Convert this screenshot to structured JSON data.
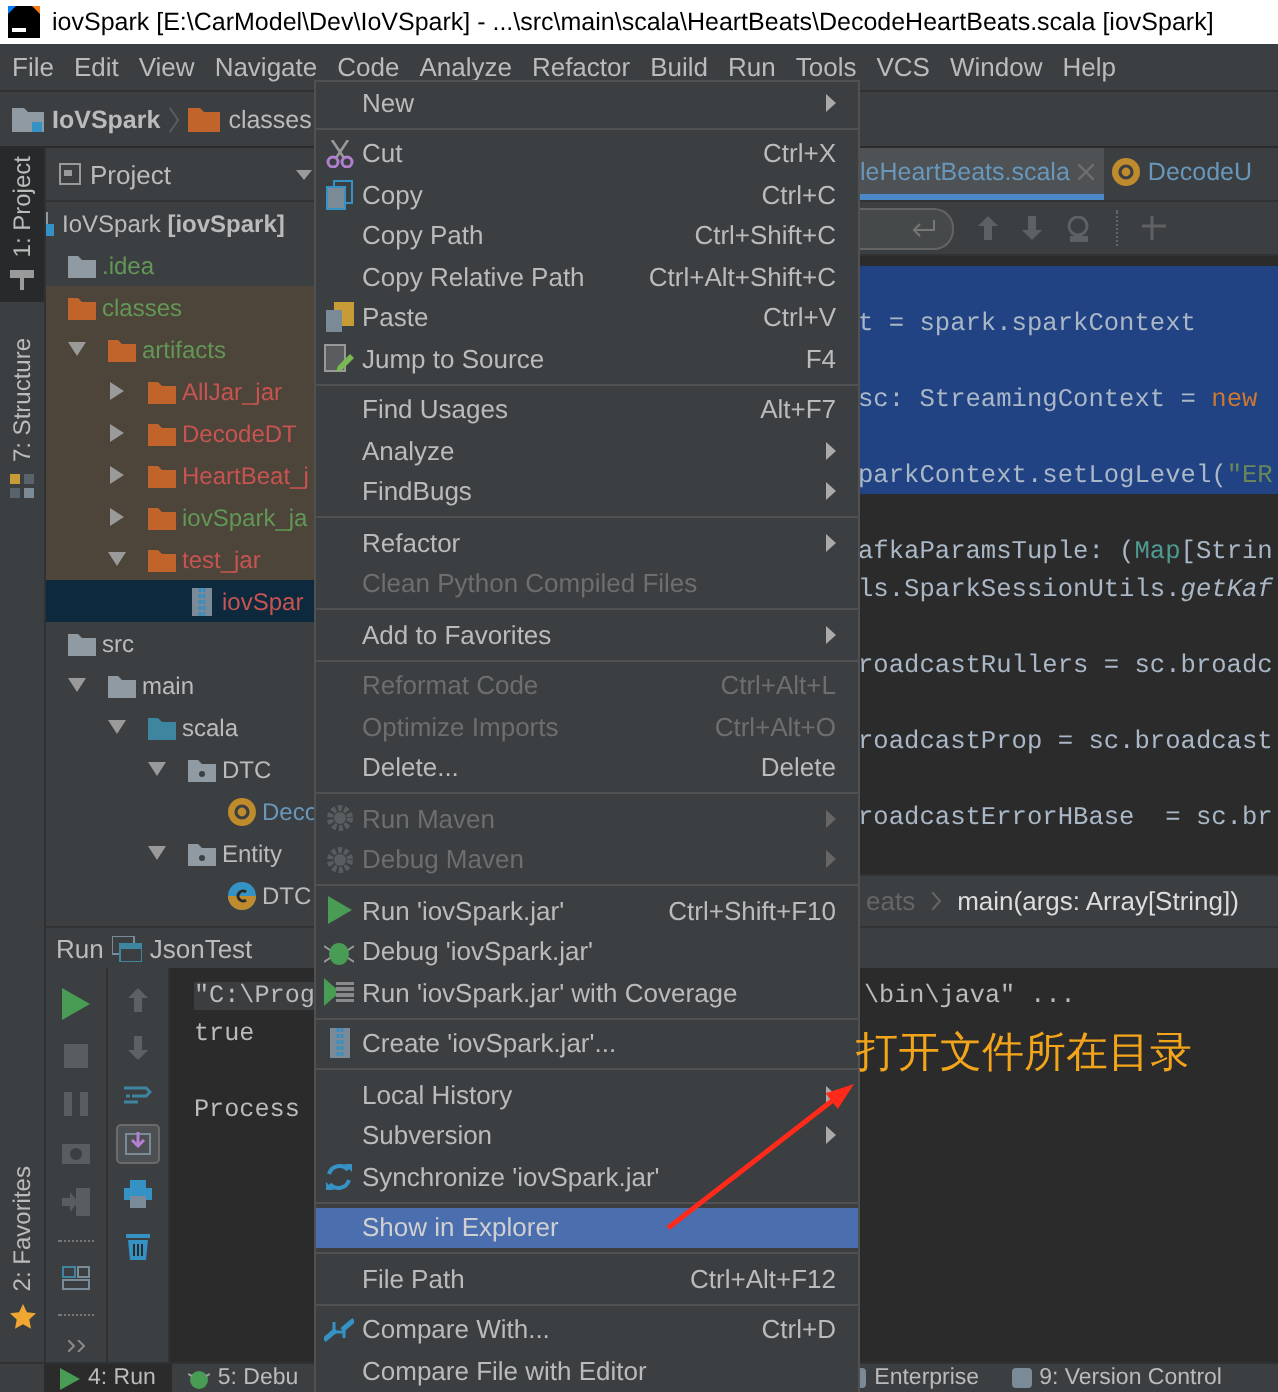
{
  "window": {
    "title": "iovSpark [E:\\CarModel\\Dev\\IoVSpark] - ...\\src\\main\\scala\\HeartBeats\\DecodeHeartBeats.scala [iovSpark]"
  },
  "menu_bar": [
    "File",
    "Edit",
    "View",
    "Navigate",
    "Code",
    "Analyze",
    "Refactor",
    "Build",
    "Run",
    "Tools",
    "VCS",
    "Window",
    "Help"
  ],
  "nav_bar": [
    {
      "label": "IoVSpark",
      "kind": "project"
    },
    {
      "label": "classes",
      "kind": "excluded-folder"
    }
  ],
  "tool_stripe": {
    "top": [
      {
        "label": "1: Project",
        "selected": true
      },
      {
        "label": "7: Structure",
        "selected": false
      }
    ],
    "bottom": [
      {
        "label": "2: Favorites",
        "selected": false
      }
    ]
  },
  "project_panel": {
    "title": "Project",
    "tree": [
      {
        "label": "IoVSpark **[iovSpark]**",
        "kind": "module",
        "color": "#bbbbbb",
        "selected": false,
        "excluded": false,
        "children": [
          {
            "label": ".idea",
            "kind": "folder",
            "color": "#629755",
            "selected": false,
            "excluded": false
          },
          {
            "label": "classes",
            "kind": "excluded-folder",
            "color": "#629755",
            "selected": false,
            "excluded": true,
            "children": [
              {
                "label": "artifacts",
                "kind": "excluded-folder",
                "color": "#629755",
                "selected": false,
                "excluded": true,
                "expanded": true,
                "children": [
                  {
                    "label": "AllJar_jar",
                    "kind": "excluded-folder",
                    "color": "#c75450",
                    "selected": false,
                    "excluded": true,
                    "expanded": false
                  },
                  {
                    "label": "DecodeDT",
                    "kind": "excluded-folder",
                    "color": "#c75450",
                    "selected": false,
                    "excluded": true,
                    "expanded": false
                  },
                  {
                    "label": "HeartBeat_j",
                    "kind": "excluded-folder",
                    "color": "#c75450",
                    "selected": false,
                    "excluded": true,
                    "expanded": false
                  },
                  {
                    "label": "iovSpark_ja",
                    "kind": "excluded-folder",
                    "color": "#629755",
                    "selected": false,
                    "excluded": true,
                    "expanded": false
                  },
                  {
                    "label": "test_jar",
                    "kind": "excluded-folder",
                    "color": "#c75450",
                    "selected": false,
                    "excluded": true,
                    "expanded": true,
                    "children": [
                      {
                        "label": "iovSpar",
                        "kind": "jar",
                        "color": "#c75450",
                        "selected": true,
                        "excluded": true
                      }
                    ]
                  }
                ]
              }
            ]
          },
          {
            "label": "src",
            "kind": "folder",
            "color": "#bbbbbb",
            "selected": false,
            "excluded": false,
            "children": [
              {
                "label": "main",
                "kind": "folder",
                "color": "#bbbbbb",
                "selected": false,
                "excluded": false,
                "expanded": true,
                "children": [
                  {
                    "label": "scala",
                    "kind": "source-folder",
                    "color": "#bbbbbb",
                    "selected": false,
                    "excluded": false,
                    "expanded": true,
                    "children": [
                      {
                        "label": "DTC",
                        "kind": "package",
                        "color": "#bbbbbb",
                        "selected": false,
                        "excluded": false,
                        "expanded": true,
                        "children": [
                          {
                            "label": "Deco",
                            "kind": "object",
                            "color": "#6897bb",
                            "selected": false,
                            "excluded": false
                          }
                        ]
                      },
                      {
                        "label": "Entity",
                        "kind": "package",
                        "color": "#bbbbbb",
                        "selected": false,
                        "excluded": false,
                        "expanded": true,
                        "children": [
                          {
                            "label": "DTC",
                            "kind": "class",
                            "color": "#bbbbbb",
                            "selected": false,
                            "excluded": false
                          }
                        ]
                      }
                    ]
                  }
                ]
              }
            ]
          }
        ]
      }
    ]
  },
  "editor": {
    "tabs": [
      {
        "label": "leHeartBeats.scala",
        "selected": true
      },
      {
        "label": "DecodeU",
        "selected": false
      }
    ],
    "lines": [
      {
        "kind": "blank",
        "selected": true
      },
      {
        "kind": "code",
        "selected": true,
        "segments": [
          {
            "kind": "plain",
            "text": "t = spark.sparkContext"
          }
        ]
      },
      {
        "kind": "blank",
        "selected": true
      },
      {
        "kind": "code",
        "selected": true,
        "segments": [
          {
            "kind": "plain",
            "text": "sc: StreamingContext = "
          },
          {
            "kind": "keyword",
            "text": "new"
          }
        ]
      },
      {
        "kind": "blank",
        "selected": true
      },
      {
        "kind": "code",
        "selected": true,
        "segments": [
          {
            "kind": "plain",
            "text": "parkContext.setLogLevel("
          },
          {
            "kind": "string",
            "text": "\"ER"
          }
        ]
      },
      {
        "kind": "blank",
        "selected": false
      },
      {
        "kind": "code",
        "selected": false,
        "segments": [
          {
            "kind": "plain",
            "text": "afkaParamsTuple: ("
          },
          {
            "kind": "type",
            "text": "Map"
          },
          {
            "kind": "plain",
            "text": "[Strin"
          }
        ]
      },
      {
        "kind": "code",
        "selected": false,
        "segments": [
          {
            "kind": "plain",
            "text": "ls.SparkSessionUtils."
          },
          {
            "kind": "italic",
            "text": "getKaf"
          }
        ]
      },
      {
        "kind": "blank",
        "selected": false
      },
      {
        "kind": "code",
        "selected": false,
        "segments": [
          {
            "kind": "plain",
            "text": "roadcastRullers = sc.broadc"
          }
        ]
      },
      {
        "kind": "blank",
        "selected": false
      },
      {
        "kind": "code",
        "selected": false,
        "segments": [
          {
            "kind": "plain",
            "text": "roadcastProp = sc.broadcast"
          }
        ]
      },
      {
        "kind": "blank",
        "selected": false
      },
      {
        "kind": "code",
        "selected": false,
        "segments": [
          {
            "kind": "plain",
            "text": "roadcastErrorHBase  = sc.br"
          }
        ]
      }
    ],
    "breadcrumb": [
      "eats",
      "main(args: Array[String])"
    ]
  },
  "run_panel": {
    "title": "Run",
    "config": "JsonTest",
    "console": [
      {
        "kind": "text",
        "left": "\"C:\\Prog",
        "right": "\\bin\\java\" ...",
        "highlighted": true
      },
      {
        "kind": "text",
        "left": "true",
        "highlighted": false
      },
      {
        "kind": "blank"
      },
      {
        "kind": "text",
        "left": "Process",
        "highlighted": false
      }
    ]
  },
  "context_menu": {
    "groups": [
      {
        "items": [
          {
            "label": "New",
            "submenu": true,
            "disabled": false,
            "selected": false
          }
        ]
      },
      {
        "items": [
          {
            "label": "Cut",
            "shortcut": "Ctrl+X",
            "submenu": false,
            "disabled": false,
            "selected": false
          },
          {
            "label": "Copy",
            "shortcut": "Ctrl+C",
            "submenu": false,
            "disabled": false,
            "selected": false
          },
          {
            "label": "Copy Path",
            "shortcut": "Ctrl+Shift+C",
            "submenu": false,
            "disabled": false,
            "selected": false
          },
          {
            "label": "Copy Relative Path",
            "shortcut": "Ctrl+Alt+Shift+C",
            "submenu": false,
            "disabled": false,
            "selected": false
          },
          {
            "label": "Paste",
            "shortcut": "Ctrl+V",
            "submenu": false,
            "disabled": false,
            "selected": false
          },
          {
            "label": "Jump to Source",
            "shortcut": "F4",
            "submenu": false,
            "disabled": false,
            "selected": false
          }
        ]
      },
      {
        "items": [
          {
            "label": "Find Usages",
            "shortcut": "Alt+F7",
            "submenu": false,
            "disabled": false,
            "selected": false
          },
          {
            "label": "Analyze",
            "submenu": true,
            "disabled": false,
            "selected": false
          },
          {
            "label": "FindBugs",
            "submenu": true,
            "disabled": false,
            "selected": false
          }
        ]
      },
      {
        "items": [
          {
            "label": "Refactor",
            "submenu": true,
            "disabled": false,
            "selected": false
          },
          {
            "label": "Clean Python Compiled Files",
            "submenu": false,
            "disabled": true,
            "selected": false
          }
        ]
      },
      {
        "items": [
          {
            "label": "Add to Favorites",
            "submenu": true,
            "disabled": false,
            "selected": false
          }
        ]
      },
      {
        "items": [
          {
            "label": "Reformat Code",
            "shortcut": "Ctrl+Alt+L",
            "submenu": false,
            "disabled": true,
            "selected": false
          },
          {
            "label": "Optimize Imports",
            "shortcut": "Ctrl+Alt+O",
            "submenu": false,
            "disabled": true,
            "selected": false
          },
          {
            "label": "Delete...",
            "shortcut": "Delete",
            "submenu": false,
            "disabled": false,
            "selected": false
          }
        ]
      },
      {
        "items": [
          {
            "label": "Run Maven",
            "submenu": true,
            "disabled": true,
            "selected": false
          },
          {
            "label": "Debug Maven",
            "submenu": true,
            "disabled": true,
            "selected": false
          }
        ]
      },
      {
        "items": [
          {
            "label": "Run 'iovSpark.jar'",
            "shortcut": "Ctrl+Shift+F10",
            "submenu": false,
            "disabled": false,
            "selected": false
          },
          {
            "label": "Debug 'iovSpark.jar'",
            "submenu": false,
            "disabled": false,
            "selected": false
          },
          {
            "label": "Run 'iovSpark.jar' with Coverage",
            "submenu": false,
            "disabled": false,
            "selected": false
          }
        ]
      },
      {
        "items": [
          {
            "label": "Create 'iovSpark.jar'...",
            "submenu": false,
            "disabled": false,
            "selected": false
          }
        ]
      },
      {
        "items": [
          {
            "label": "Local History",
            "submenu": true,
            "disabled": false,
            "selected": false
          },
          {
            "label": "Subversion",
            "submenu": true,
            "disabled": false,
            "selected": false
          },
          {
            "label": "Synchronize 'iovSpark.jar'",
            "submenu": false,
            "disabled": false,
            "selected": false
          }
        ]
      },
      {
        "items": [
          {
            "label": "Show in Explorer",
            "submenu": false,
            "disabled": false,
            "selected": true
          }
        ]
      },
      {
        "items": [
          {
            "label": "File Path",
            "shortcut": "Ctrl+Alt+F12",
            "submenu": false,
            "disabled": false,
            "selected": false
          }
        ]
      },
      {
        "items": [
          {
            "label": "Compare With...",
            "shortcut": "Ctrl+D",
            "submenu": false,
            "disabled": false,
            "selected": false
          },
          {
            "label": "Compare File with Editor",
            "submenu": false,
            "disabled": false,
            "selected": false
          }
        ]
      }
    ]
  },
  "annotation": {
    "text": "打开文件所在目录"
  },
  "bottom_bar": {
    "left": [
      {
        "label": "4: Run",
        "selected": true
      },
      {
        "label": "5: Debu",
        "selected": false
      }
    ],
    "right": [
      {
        "label": "Enterprise",
        "selected": false
      },
      {
        "label": "9: Version Control",
        "selected": false
      }
    ]
  }
}
